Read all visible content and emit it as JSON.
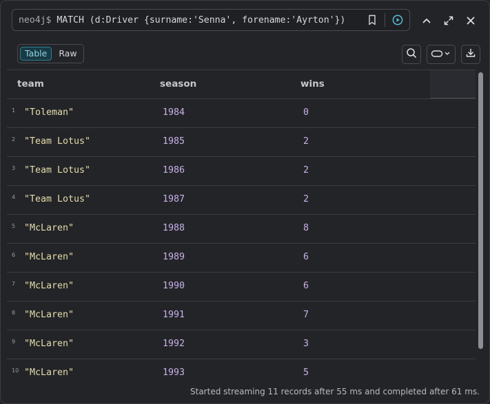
{
  "query": {
    "prompt": "neo4j$",
    "text": "MATCH (d:Driver {surname:'Senna', forename:'Ayrton'})",
    "icons": [
      "bookmark-icon",
      "run-icon"
    ]
  },
  "window_controls": {
    "icons": [
      "collapse-icon",
      "fullscreen-icon",
      "close-icon"
    ]
  },
  "toolbar": {
    "view_toggle": {
      "table_label": "Table",
      "raw_label": "Raw",
      "active": "Table"
    },
    "icons": [
      "search-icon",
      "row-height-icon",
      "download-icon"
    ]
  },
  "table": {
    "columns": [
      "team",
      "season",
      "wins"
    ],
    "rows": [
      {
        "num": "1",
        "team": "\"Toleman\"",
        "season": "1984",
        "wins": "0"
      },
      {
        "num": "2",
        "team": "\"Team Lotus\"",
        "season": "1985",
        "wins": "2"
      },
      {
        "num": "3",
        "team": "\"Team Lotus\"",
        "season": "1986",
        "wins": "2"
      },
      {
        "num": "4",
        "team": "\"Team Lotus\"",
        "season": "1987",
        "wins": "2"
      },
      {
        "num": "5",
        "team": "\"McLaren\"",
        "season": "1988",
        "wins": "8"
      },
      {
        "num": "6",
        "team": "\"McLaren\"",
        "season": "1989",
        "wins": "6"
      },
      {
        "num": "7",
        "team": "\"McLaren\"",
        "season": "1990",
        "wins": "6"
      },
      {
        "num": "8",
        "team": "\"McLaren\"",
        "season": "1991",
        "wins": "7"
      },
      {
        "num": "9",
        "team": "\"McLaren\"",
        "season": "1992",
        "wins": "3"
      },
      {
        "num": "10",
        "team": "\"McLaren\"",
        "season": "1993",
        "wins": "5"
      }
    ]
  },
  "status": {
    "text": "Started streaming 11 records after 55 ms and completed after 61 ms."
  },
  "colors": {
    "background": "#232428",
    "string_value": "#e5dcaa",
    "number_value": "#c9b2e8",
    "accent": "#8fd3e6",
    "border": "#3b3d42"
  }
}
